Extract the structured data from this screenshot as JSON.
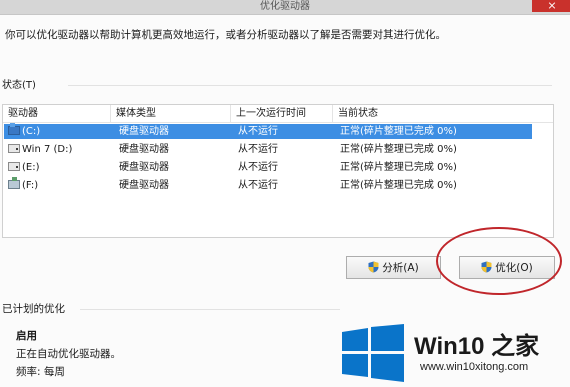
{
  "window": {
    "title": "优化驱动器"
  },
  "description": "你可以优化驱动器以帮助计算机更高效地运行，或者分析驱动器以了解是否需要对其进行优化。",
  "status_section": {
    "label": "状态(T)"
  },
  "table": {
    "headers": [
      "驱动器",
      "媒体类型",
      "上一次运行时间",
      "当前状态"
    ],
    "rows": [
      {
        "drive": "(C:)",
        "icon": "system-drive-icon",
        "media": "硬盘驱动器",
        "last_run": "从不运行",
        "status": "正常(碎片整理已完成 0%)",
        "selected": true
      },
      {
        "drive": "Win 7 (D:)",
        "icon": "hard-drive-icon",
        "media": "硬盘驱动器",
        "last_run": "从不运行",
        "status": "正常(碎片整理已完成 0%)",
        "selected": false
      },
      {
        "drive": "(E:)",
        "icon": "hard-drive-icon",
        "media": "硬盘驱动器",
        "last_run": "从不运行",
        "status": "正常(碎片整理已完成 0%)",
        "selected": false
      },
      {
        "drive": "(F:)",
        "icon": "image-drive-icon",
        "media": "硬盘驱动器",
        "last_run": "从不运行",
        "status": "正常(碎片整理已完成 0%)",
        "selected": false
      }
    ]
  },
  "buttons": {
    "analyze": "分析(A)",
    "optimize": "优化(O)"
  },
  "schedule": {
    "label": "已计划的优化",
    "enable": "启用",
    "status": "正在自动优化驱动器。",
    "frequency": "频率: 每周"
  },
  "watermark": {
    "title": "Win10 之家",
    "url": "www.win10xitong.com"
  },
  "colors": {
    "selection": "#3d8ee3",
    "highlight_circle": "#c0262b",
    "logo_blue": "#0078d7"
  }
}
